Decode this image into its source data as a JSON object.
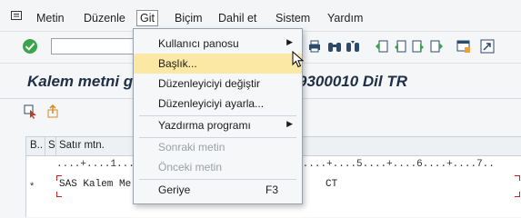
{
  "menubar": {
    "items": [
      "Metin",
      "Düzenle",
      "Git",
      "Biçim",
      "Dahil et",
      "Sistem",
      "Yardım"
    ],
    "active_index": 2
  },
  "toolbar": {
    "command_value": ""
  },
  "title": {
    "left": "Kalem metni g",
    "right": "9300010 Dil TR"
  },
  "editor": {
    "columns": [
      "B..",
      "S",
      "Satır mtn."
    ],
    "ruler": "....+....1..............................4....+....5....+....6....+....7..",
    "row_marker": "*",
    "line_left": "SAS Kalem Me",
    "line_right": "CT"
  },
  "menu": {
    "items": [
      {
        "label": "Kullanıcı panosu",
        "submenu": true
      },
      {
        "label": "Başlık...",
        "highlighted": true
      },
      {
        "label": "Düzenleyiciyi değiştir"
      },
      {
        "label": "Düzenleyiciyi ayarla..."
      },
      {
        "label": "Yazdırma programı",
        "submenu": true
      },
      {
        "label": "Sonraki metin",
        "disabled": true
      },
      {
        "label": "Önceki metin",
        "disabled": true
      },
      {
        "label": "Geriye",
        "shortcut": "F3"
      }
    ],
    "submenu_arrow": "▶"
  },
  "colors": {
    "highlight": "#fbe8a4",
    "title_text": "#1f2f47",
    "ok_green": "#3aa54a",
    "marker_red": "#cc2222"
  },
  "icons": [
    "app-menu-icon",
    "ok-icon",
    "print-icon",
    "find-icon",
    "find-next-icon",
    "first-page-icon",
    "previous-page-icon",
    "next-page-icon",
    "last-page-icon",
    "new-session-icon",
    "shortcut-icon",
    "select-icon",
    "export-icon",
    "mouse-cursor-icon"
  ]
}
